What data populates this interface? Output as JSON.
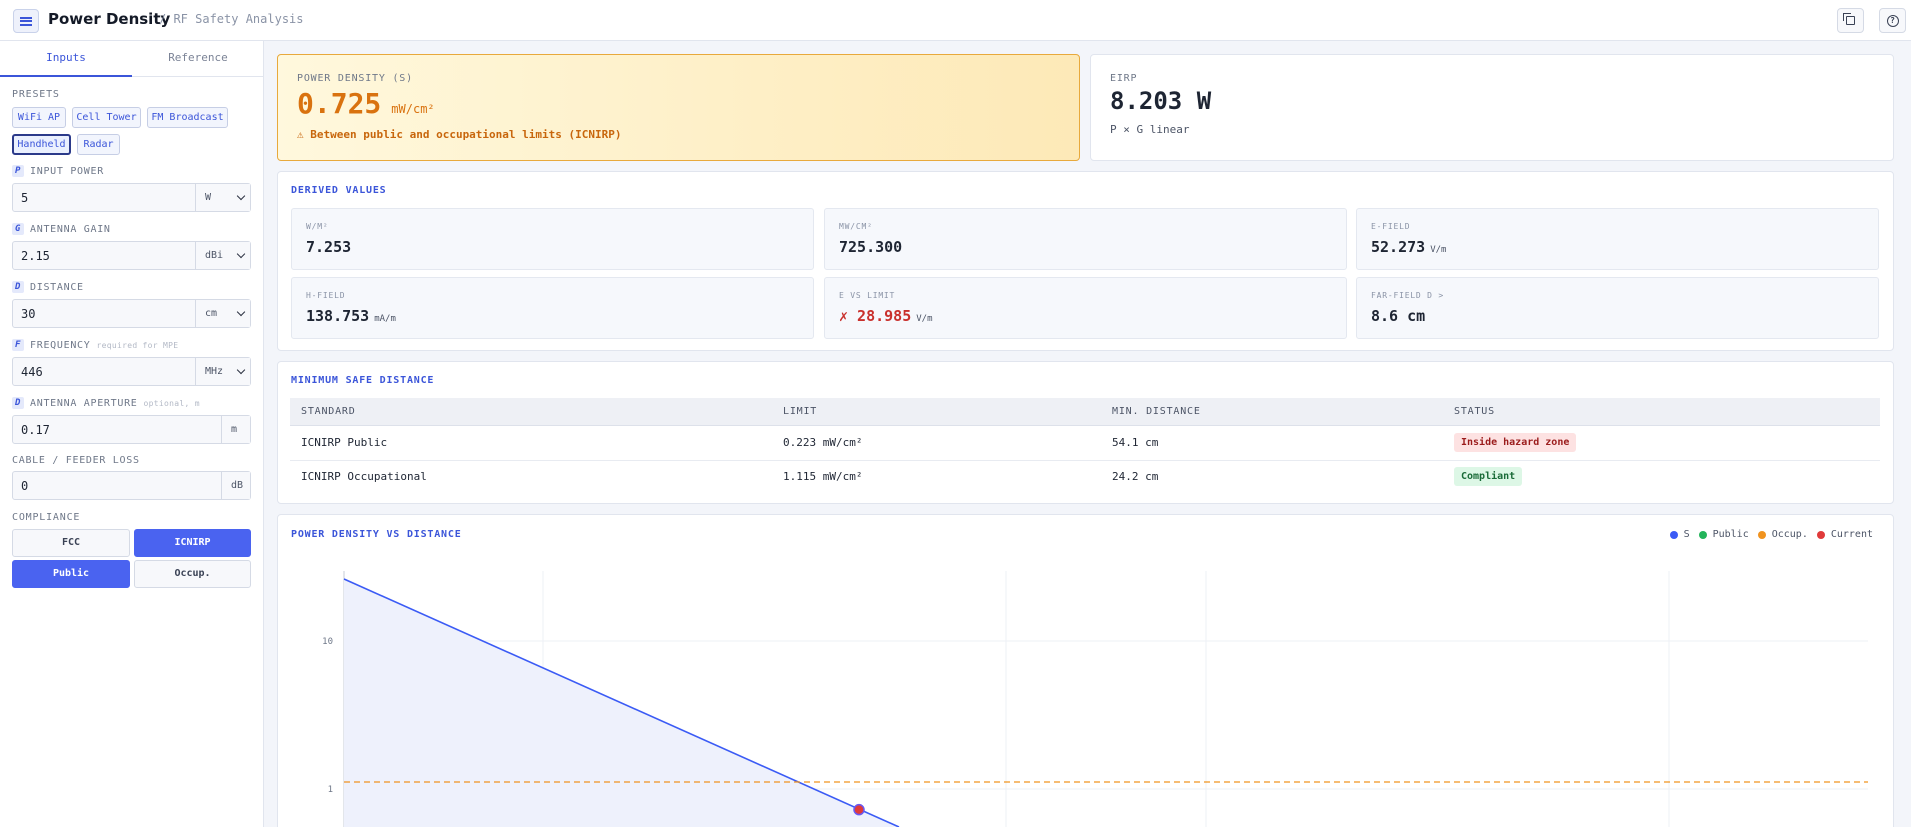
{
  "header": {
    "title": "Power Density",
    "subtitle": "/ RF Safety Analysis",
    "copy_icon": "copy-icon",
    "help_icon": "help-icon"
  },
  "sidebar": {
    "tabs": [
      {
        "label": "Inputs",
        "active": true
      },
      {
        "label": "Reference",
        "active": false
      }
    ],
    "presets_label": "PRESETS",
    "presets": [
      {
        "label": "WiFi AP"
      },
      {
        "label": "Cell Tower"
      },
      {
        "label": "FM Broadcast"
      },
      {
        "label": "Handheld",
        "active": true
      },
      {
        "label": "Radar"
      }
    ],
    "fields": [
      {
        "tag": "P",
        "label": "INPUT POWER",
        "value": "5",
        "unit": "W",
        "dropdown": true
      },
      {
        "tag": "G",
        "label": "ANTENNA GAIN",
        "value": "2.15",
        "unit": "dBi",
        "dropdown": true
      },
      {
        "tag": "D",
        "label": "DISTANCE",
        "value": "30",
        "unit": "cm",
        "dropdown": true
      },
      {
        "tag": "F",
        "label": "FREQUENCY",
        "hint": "required for MPE",
        "value": "446",
        "unit": "MHz",
        "dropdown": true
      },
      {
        "tag": "D",
        "label": "ANTENNA APERTURE",
        "hint": "optional, m",
        "value": "0.17",
        "unit": "m",
        "dropdown": false
      },
      {
        "label": "CABLE / FEEDER LOSS",
        "value": "0",
        "unit": "dB",
        "dropdown": false
      }
    ],
    "compliance_label": "COMPLIANCE",
    "standard_options": [
      {
        "label": "FCC",
        "on": false
      },
      {
        "label": "ICNIRP",
        "on": true
      }
    ],
    "population_options": [
      {
        "label": "Public",
        "on": true
      },
      {
        "label": "Occup.",
        "on": false
      }
    ]
  },
  "result": {
    "label": "POWER DENSITY (S)",
    "value": "0.725",
    "unit": "mW/cm²",
    "warning": "⚠ Between public and occupational limits (ICNIRP)",
    "warn_color": "#d9720f"
  },
  "eirp": {
    "label": "EIRP",
    "value": "8.203 W",
    "note": "P × G linear"
  },
  "derived": {
    "title": "DERIVED VALUES",
    "items": [
      {
        "label": "W/M²",
        "value": "7.253",
        "unit": ""
      },
      {
        "label": "MW/CM²",
        "value": "725.300",
        "unit": ""
      },
      {
        "label": "E-FIELD",
        "value": "52.273",
        "unit": "V/m"
      },
      {
        "label": "H-FIELD",
        "value": "138.753",
        "unit": "mA/m"
      },
      {
        "label": "E VS LIMIT",
        "value": "✗ 28.985",
        "unit": "V/m",
        "bad": true
      },
      {
        "label": "FAR-FIELD D >",
        "value": "8.6 cm",
        "unit": ""
      }
    ]
  },
  "safe_distance": {
    "title": "MINIMUM SAFE DISTANCE",
    "columns": [
      "STANDARD",
      "LIMIT",
      "MIN. DISTANCE",
      "STATUS"
    ],
    "rows": [
      {
        "standard": "ICNIRP Public",
        "limit": "0.223 mW/cm²",
        "distance": "54.1 cm",
        "status": "Inside hazard zone",
        "ok": false
      },
      {
        "standard": "ICNIRP Occupational",
        "limit": "1.115 mW/cm²",
        "distance": "24.2 cm",
        "status": "Compliant",
        "ok": true
      }
    ]
  },
  "chart_data": {
    "type": "line",
    "title": "POWER DENSITY VS DISTANCE",
    "y_scale": "log",
    "y_ticks": [
      "10",
      "1"
    ],
    "grid": true,
    "legend_placement": "top-right",
    "legend": [
      {
        "name": "S",
        "color": "#3b5bf5"
      },
      {
        "name": "Public",
        "color": "#22b45a"
      },
      {
        "name": "Occup.",
        "color": "#f0931f"
      },
      {
        "name": "Current",
        "color": "#e03a3a"
      }
    ],
    "occupational_limit": 1.115,
    "current_point_density": 0.725
  }
}
